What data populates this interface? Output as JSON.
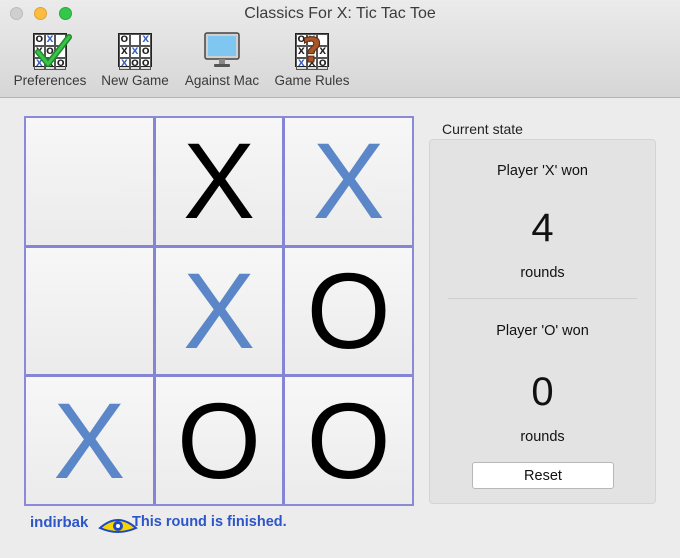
{
  "window": {
    "title": "Classics For X: Tic Tac Toe"
  },
  "toolbar": {
    "items": [
      {
        "label": "Preferences",
        "icon": "preferences-icon"
      },
      {
        "label": "New Game",
        "icon": "new-game-icon"
      },
      {
        "label": "Against Mac",
        "icon": "monitor-icon"
      },
      {
        "label": "Game Rules",
        "icon": "question-icon"
      }
    ]
  },
  "board": {
    "cells": [
      "",
      "X",
      "X",
      "",
      "X",
      "O",
      "X",
      "O",
      "O"
    ],
    "cell_colors": [
      "",
      "dark",
      "blue",
      "",
      "blue",
      "dark",
      "blue",
      "dark",
      "dark"
    ]
  },
  "state": {
    "caption": "Current state",
    "player_x": {
      "label": "Player 'X' won",
      "count": "4",
      "unit": "rounds"
    },
    "player_o": {
      "label": "Player 'O' won",
      "count": "0",
      "unit": "rounds"
    },
    "reset_label": "Reset"
  },
  "footer": {
    "brand": "indirbak",
    "status": "This round is finished."
  },
  "colors": {
    "grid_lines": "#8585d6",
    "blue_mark": "#5b87c9",
    "dark_mark": "#000000",
    "status_text": "#2b55c9"
  }
}
